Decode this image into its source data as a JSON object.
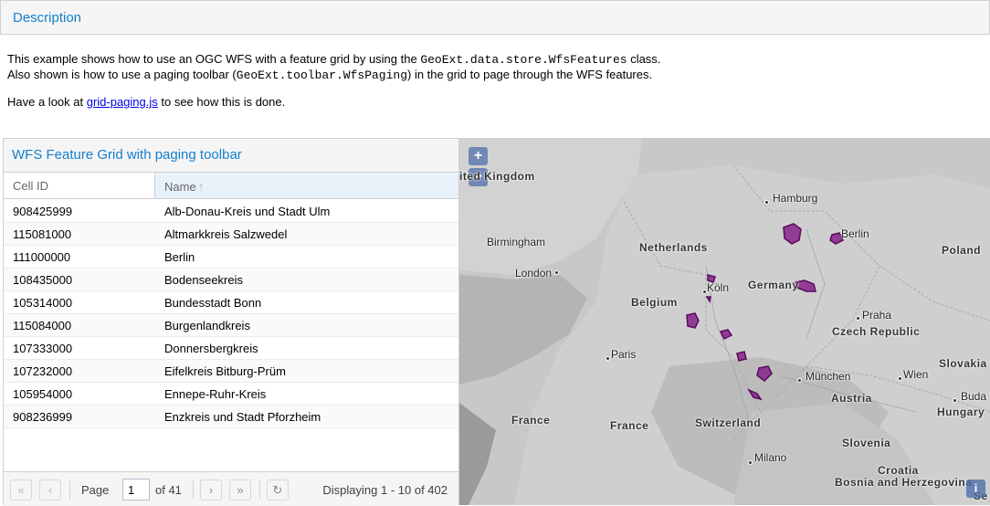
{
  "description": {
    "title": "Description",
    "line1_pre": "This example shows how to use an OGC WFS with a feature grid by using the ",
    "line1_code": "GeoExt.data.store.WfsFeatures",
    "line1_post": " class.",
    "line2_pre": "Also shown is how to use a paging toolbar (",
    "line2_code": "GeoExt.toolbar.WfsPaging",
    "line2_post": ") in the grid to page through the WFS features.",
    "line3_pre": "Have a look at ",
    "line3_link": "grid-paging.js",
    "line3_post": " to see how this is done."
  },
  "grid": {
    "title": "WFS Feature Grid with paging toolbar",
    "columns": [
      "Cell ID",
      "Name"
    ],
    "sort_icon": "arrow-up-icon",
    "rows": [
      {
        "cell_id": "908425999",
        "name": "Alb-Donau-Kreis und Stadt Ulm"
      },
      {
        "cell_id": "115081000",
        "name": "Altmarkkreis Salzwedel"
      },
      {
        "cell_id": "111000000",
        "name": "Berlin"
      },
      {
        "cell_id": "108435000",
        "name": "Bodenseekreis"
      },
      {
        "cell_id": "105314000",
        "name": "Bundesstadt Bonn"
      },
      {
        "cell_id": "115084000",
        "name": "Burgenlandkreis"
      },
      {
        "cell_id": "107333000",
        "name": "Donnersbergkreis"
      },
      {
        "cell_id": "107232000",
        "name": "Eifelkreis Bitburg-Prüm"
      },
      {
        "cell_id": "105954000",
        "name": "Ennepe-Ruhr-Kreis"
      },
      {
        "cell_id": "908236999",
        "name": "Enzkreis und Stadt Pforzheim"
      }
    ],
    "pager": {
      "page_label": "Page",
      "page_value": "1",
      "of_label": "of 41",
      "display_msg": "Displaying 1 - 10 of 402"
    }
  },
  "map": {
    "zoom_in": "+",
    "zoom_out": "−",
    "info": "i",
    "countries": {
      "uk": "ited Kingdom",
      "netherlands": "Netherlands",
      "belgium": "Belgium",
      "germany": "Germany",
      "poland": "Poland",
      "czech": "Czech Republic",
      "slovakia": "Slovakia",
      "austria": "Austria",
      "hungary": "Hungary",
      "france1": "France",
      "france2": "France",
      "switzerland": "Switzerland",
      "slovenia": "Slovenia",
      "croatia": "Croatia",
      "bosnia": "Bosnia and Herzegovina",
      "se": "Se"
    },
    "cities": {
      "hamburg": "Hamburg",
      "berlin": "Berlin",
      "birmingham": "Birmingham",
      "london": "London",
      "koln": "Köln",
      "praha": "Praha",
      "paris": "Paris",
      "munchen": "München",
      "wien": "Wien",
      "buda": "Buda",
      "milano": "Milano"
    },
    "colors": {
      "feature_fill": "#8a2c8e",
      "feature_stroke": "#5a0a5e"
    }
  }
}
